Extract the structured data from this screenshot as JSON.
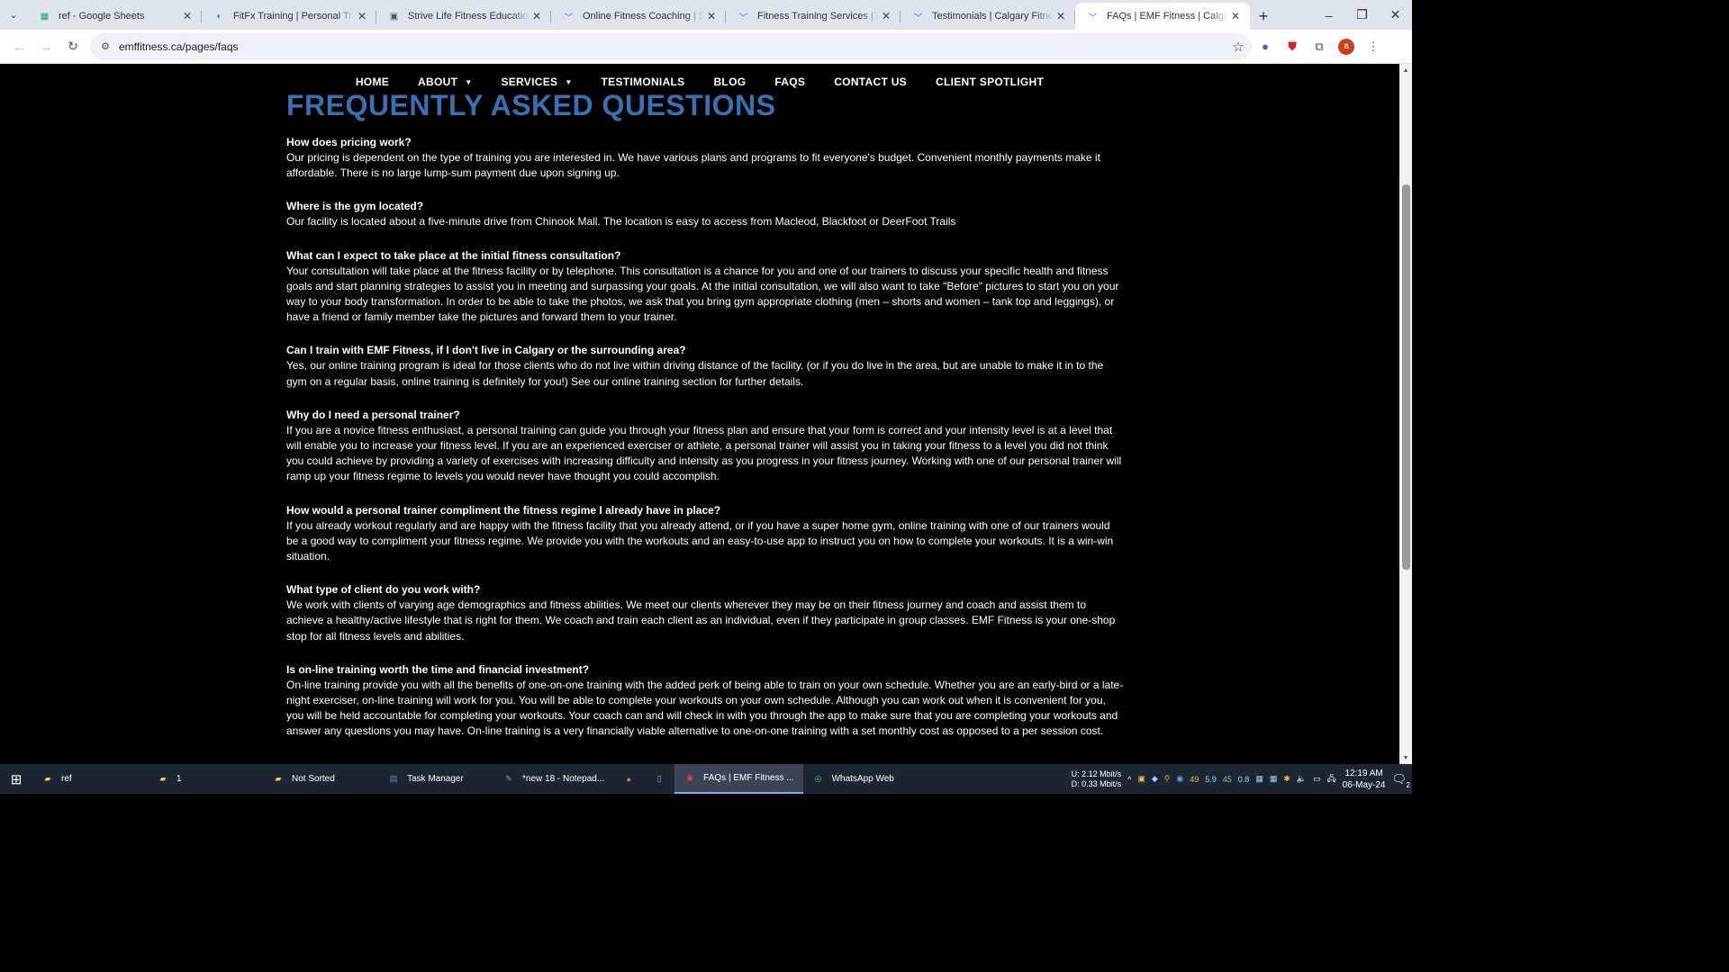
{
  "browser": {
    "tabs": [
      {
        "title": "ref - Google Sheets",
        "icon": "sheets-icon",
        "color": "#1ea362"
      },
      {
        "title": "FitFx Training | Personal Training",
        "icon": "fitfx-icon",
        "color": "#2a7ad2"
      },
      {
        "title": "Strive Life Fitness Education | C",
        "icon": "strive-icon",
        "color": "#555555"
      },
      {
        "title": "Online Fitness Coaching | Skype",
        "icon": "wix-icon",
        "color": "#3a6fc4"
      },
      {
        "title": "Fitness Training Services | Perso",
        "icon": "wix-icon",
        "color": "#3a6fc4"
      },
      {
        "title": "Testimonials | Calgary Fitness C",
        "icon": "wix-icon",
        "color": "#3a6fc4"
      },
      {
        "title": "FAQs | EMF Fitness | Calgary Fit",
        "icon": "wix-icon",
        "color": "#3a6fc4",
        "active": true
      }
    ],
    "url": "emffitness.ca/pages/faqs",
    "profile_initial": "a"
  },
  "site_nav": {
    "items": [
      "HOME",
      "ABOUT",
      "SERVICES",
      "TESTIMONIALS",
      "BLOG",
      "FAQS",
      "CONTACT US",
      "CLIENT SPOTLIGHT"
    ]
  },
  "page": {
    "title": "FREQUENTLY ASKED QUESTIONS",
    "faqs": [
      {
        "q": "How does pricing work?",
        "a": "Our pricing is dependent on the type of training you are interested in.  We have various plans and programs to fit everyone's budget.  Convenient monthly payments make it affordable.  There is no large lump-sum payment due upon signing up."
      },
      {
        "q": "Where is the gym located?",
        "a": "Our facility is located about a five-minute drive from Chinook Mall.  The location is easy to access from Macleod, Blackfoot or DeerFoot Trails"
      },
      {
        "q": "What can I expect to take place at the initial fitness consultation?",
        "a": "Your consultation will take place at the fitness facility or by telephone.  This consultation is a chance for you and one of our trainers to discuss your specific health and fitness goals and start planning strategies to assist you in meeting and surpassing your goals.  At the initial consultation, we will also want to take \"Before\" pictures to start you on your way to your body transformation.  In order to be able to take the photos, we ask that you bring gym appropriate clothing (men – shorts and women – tank top and leggings), or have a friend or family member take the pictures and forward them to your trainer."
      },
      {
        "q": "Can I train with EMF Fitness, if I don't live in Calgary or the surrounding area?",
        "a": "Yes, our online training program is ideal for those clients who do not live within driving distance of the facility.  (or if you do live in the area, but are unable to make it in to the gym on a regular basis, online training is definitely for you!)  See our online training section for further details."
      },
      {
        "q": "Why do I need a personal trainer?",
        "a": "If you are a novice fitness enthusiast, a personal training can guide you through your fitness plan and ensure that your form is correct and your intensity level is at a level that will enable you to increase your fitness level.  If you are an experienced exerciser or athlete, a personal trainer will assist you in taking your fitness to a level you did not think you could achieve by providing a variety of exercises with increasing difficulty and intensity as you progress in your fitness journey.  Working with one of our personal trainer will ramp up your fitness regime to levels you would never have thought you could accomplish."
      },
      {
        "q": "How would a personal trainer compliment the fitness regime I already have in place?",
        "a": "If you already workout regularly and are happy with the fitness facility that you already attend, or if you have a super home gym, online training with one of our trainers would be a good way to compliment your fitness regime.  We provide you with the workouts and an easy-to-use app to instruct you on how to complete your workouts.  It is a win-win situation."
      },
      {
        "q": "What type of client do you work with?",
        "a": "We work with clients of varying age demographics and fitness abilities.  We meet our clients wherever they may be on their fitness journey and coach and assist them to achieve a healthy/active lifestyle that is right for them.  We coach and train each client as an individual, even if they participate in group classes.  EMF Fitness is your one-shop stop for all fitness levels and abilities."
      },
      {
        "q": "Is on-line training worth the time and financial investment?",
        "a": "On-line training provide you with all the benefits of one-on-one training with the added perk of being able to train on your own schedule.  Whether you are an early-bird or a late-night exerciser, on-line training will work for you.  You will be able to complete your workouts on your own schedule.  Although you can work out when it is convenient for you, you will be held accountable for completing your workouts.  Your coach can and will check in with you through the app to make sure that you are completing your workouts and answer any questions you may have.  On-line training is a very financially viable alternative to one-on-one training with a set monthly cost as opposed to a per session cost."
      }
    ]
  },
  "taskbar": {
    "items": [
      {
        "label": "ref",
        "icon": "folder-icon",
        "color": "#f2c94c"
      },
      {
        "label": "1",
        "icon": "folder-icon",
        "color": "#f2c94c"
      },
      {
        "label": "Not Sorted",
        "icon": "folder-icon",
        "color": "#f2c94c"
      },
      {
        "label": "Task Manager",
        "icon": "task-manager-icon",
        "color": "#5a8fd6"
      },
      {
        "label": "*new 18 - Notepad...",
        "icon": "notepadpp-icon",
        "color": "#7bbf4a"
      },
      {
        "label": "",
        "icon": "app-icon",
        "color": "#e07a5f"
      },
      {
        "label": "",
        "icon": "document-icon",
        "color": "#9fb7d9"
      },
      {
        "label": "FAQs | EMF Fitness ...",
        "icon": "chrome-icon",
        "color": "#e8453c",
        "active": true
      },
      {
        "label": "WhatsApp Web",
        "icon": "whatsapp-icon",
        "color": "#25d366"
      }
    ],
    "network": {
      "up_label": "U:",
      "up": "2.12 Mbit/s",
      "down_label": "D:",
      "down": "0.33 Mbit/s"
    },
    "tray_numbers": [
      "49",
      "5.9",
      "45",
      "0.8"
    ],
    "time": "12:19 AM",
    "date": "06-May-24",
    "notification_count": "2"
  }
}
